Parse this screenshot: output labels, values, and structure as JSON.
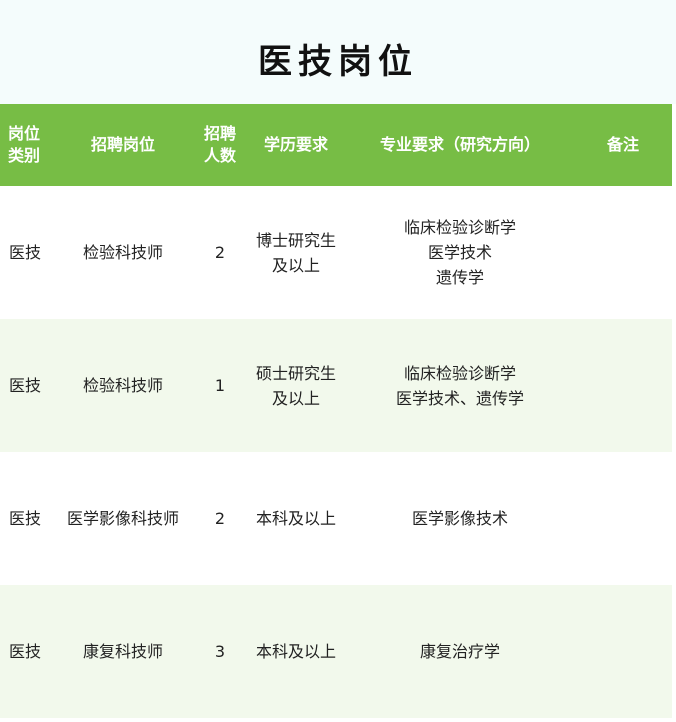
{
  "title": "医技岗位",
  "headers": {
    "category": "岗位\n类别",
    "position": "招聘岗位",
    "count": "招聘\n人数",
    "education": "学历要求",
    "major": "专业要求（研究方向）",
    "remarks": "备注"
  },
  "rows": [
    {
      "category": "医技",
      "position": "检验科技师",
      "count": "2",
      "education": "博士研究生\n及以上",
      "major": "临床检验诊断学\n医学技术\n遗传学",
      "remarks": ""
    },
    {
      "category": "医技",
      "position": "检验科技师",
      "count": "1",
      "education": "硕士研究生\n及以上",
      "major": "临床检验诊断学\n医学技术、遗传学",
      "remarks": ""
    },
    {
      "category": "医技",
      "position": "医学影像科技师",
      "count": "2",
      "education": "本科及以上",
      "major": "医学影像技术",
      "remarks": ""
    },
    {
      "category": "医技",
      "position": "康复科技师",
      "count": "3",
      "education": "本科及以上",
      "major": "康复治疗学",
      "remarks": ""
    }
  ],
  "colors": {
    "header_bg": "#77bd45",
    "title_bg": "#f4fcfc",
    "row_alt_bg": "#f2f9ec"
  }
}
